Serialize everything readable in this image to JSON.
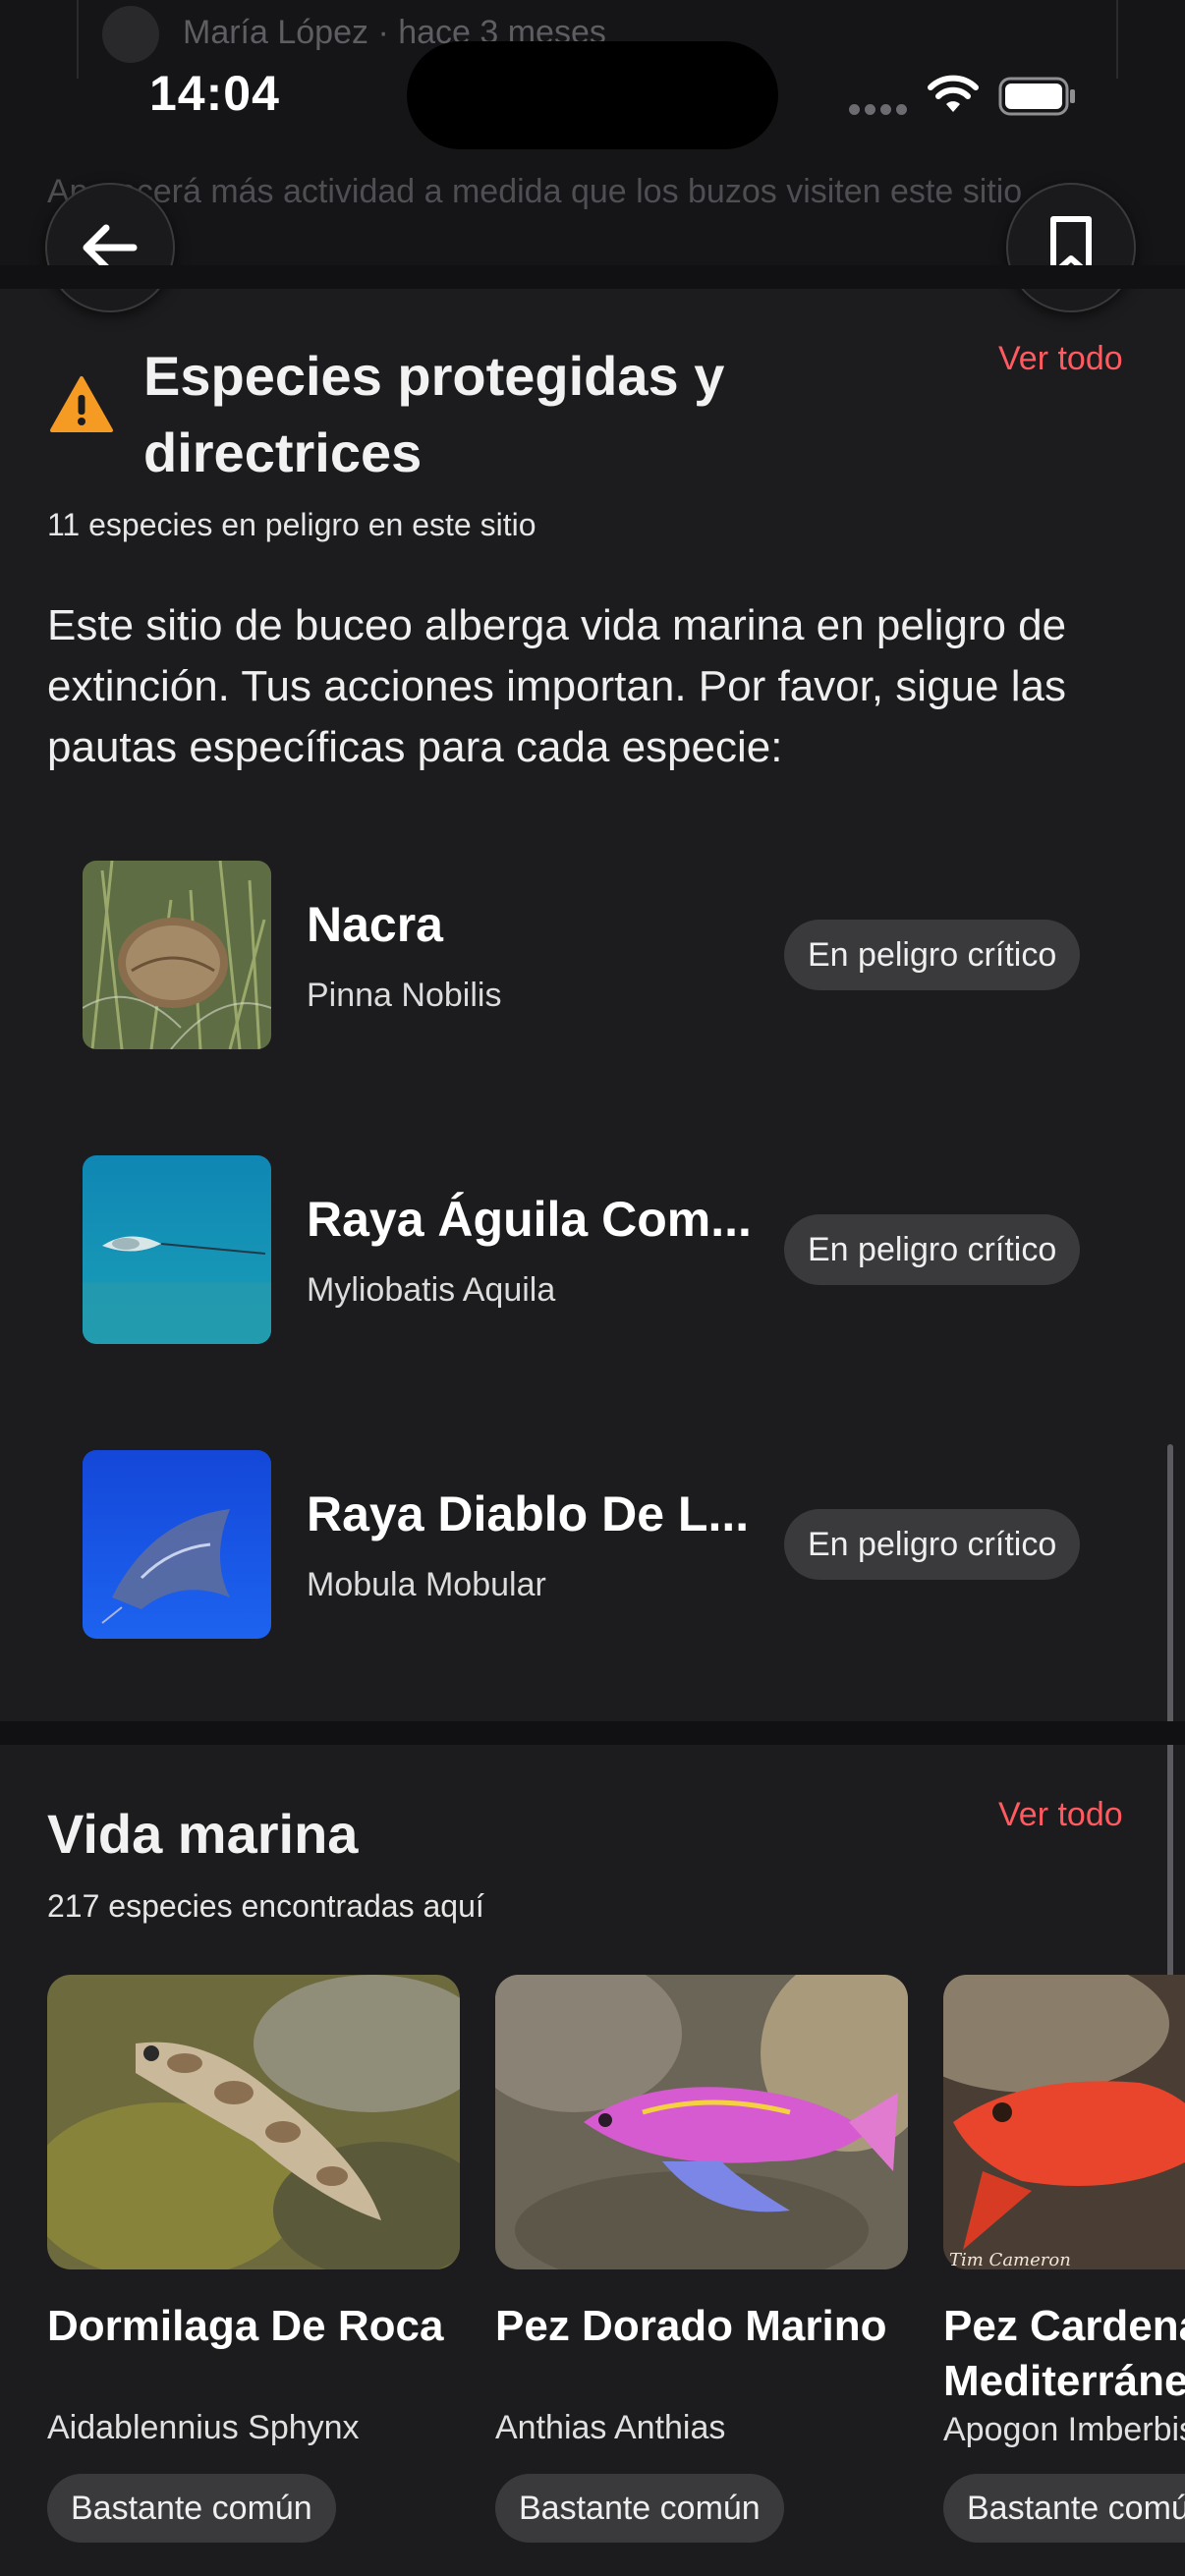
{
  "status_bar": {
    "time": "14:04"
  },
  "previous_section": {
    "comment_author": "María López · hace 3 meses",
    "note": "Aparecerá más actividad a medida que los buzos visiten este sitio"
  },
  "nav": {
    "back_icon": "arrow-left-icon",
    "bookmark_icon": "bookmark-icon"
  },
  "protected_species": {
    "title": "Especies protegidas y directrices",
    "see_all": "Ver todo",
    "subtitle": "11 especies en peligro en este sitio",
    "intro": "Este sitio de buceo alberga vida marina en peligro de extinción. Tus acciones importan. Por favor, sigue las pautas específicas para cada especie:",
    "items": [
      {
        "name": "Nacra",
        "scientific": "Pinna Nobilis",
        "status": "En peligro crítico"
      },
      {
        "name": "Raya Águila Com...",
        "scientific": "Myliobatis Aquila",
        "status": "En peligro crítico"
      },
      {
        "name": "Raya Diablo De L...",
        "scientific": "Mobula Mobular",
        "status": "En peligro crítico"
      }
    ]
  },
  "marine_life": {
    "title": "Vida marina",
    "see_all": "Ver todo",
    "subtitle": "217 especies encontradas aquí",
    "cards": [
      {
        "name": "Dormilaga De Roca",
        "scientific": "Aidablennius Sphynx",
        "abundance": "Bastante común"
      },
      {
        "name": "Pez Dorado Marino",
        "scientific": "Anthias Anthias",
        "abundance": "Bastante común"
      },
      {
        "name": "Pez Cardenal Mediterráneo",
        "scientific": "Apogon Imberbis",
        "abundance": "Bastante común",
        "photo_credit": "Tim Cameron"
      }
    ]
  },
  "colors": {
    "accent": "#ff5a5f",
    "warning": "#f59a23",
    "background": "#1c1c1e",
    "badge": "#3a3a3c"
  }
}
